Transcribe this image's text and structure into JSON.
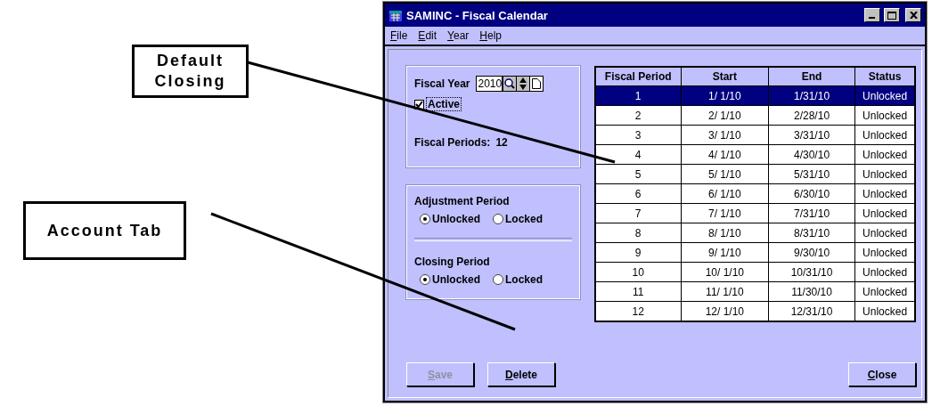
{
  "callouts": [
    {
      "text": "Default Closing"
    },
    {
      "text": "Account Tab"
    }
  ],
  "window": {
    "title": "SAMINC - Fiscal Calendar"
  },
  "menu": [
    {
      "label": "File"
    },
    {
      "label": "Edit"
    },
    {
      "label": "Year"
    },
    {
      "label": "Help"
    }
  ],
  "fiscal_year": {
    "label": "Fiscal Year",
    "value": "2010",
    "active": {
      "label": "Active",
      "checked": true
    },
    "periods_label": "Fiscal Periods:",
    "periods_value": "12"
  },
  "adjustment_period": {
    "label": "Adjustment Period",
    "options": [
      {
        "label": "Unlocked",
        "selected": true
      },
      {
        "label": "Locked",
        "selected": false
      }
    ]
  },
  "closing_period": {
    "label": "Closing Period",
    "options": [
      {
        "label": "Unlocked",
        "selected": true
      },
      {
        "label": "Locked",
        "selected": false
      }
    ]
  },
  "table": {
    "columns": [
      "Fiscal Period",
      "Start",
      "End",
      "Status"
    ],
    "rows": [
      {
        "cells": [
          "1",
          "1/ 1/10",
          "1/31/10",
          "Unlocked"
        ],
        "selected": true
      },
      {
        "cells": [
          "2",
          "2/ 1/10",
          "2/28/10",
          "Unlocked"
        ],
        "selected": false
      },
      {
        "cells": [
          "3",
          "3/ 1/10",
          "3/31/10",
          "Unlocked"
        ],
        "selected": false
      },
      {
        "cells": [
          "4",
          "4/ 1/10",
          "4/30/10",
          "Unlocked"
        ],
        "selected": false
      },
      {
        "cells": [
          "5",
          "5/ 1/10",
          "5/31/10",
          "Unlocked"
        ],
        "selected": false
      },
      {
        "cells": [
          "6",
          "6/ 1/10",
          "6/30/10",
          "Unlocked"
        ],
        "selected": false
      },
      {
        "cells": [
          "7",
          "7/ 1/10",
          "7/31/10",
          "Unlocked"
        ],
        "selected": false
      },
      {
        "cells": [
          "8",
          "8/ 1/10",
          "8/31/10",
          "Unlocked"
        ],
        "selected": false
      },
      {
        "cells": [
          "9",
          "9/ 1/10",
          "9/30/10",
          "Unlocked"
        ],
        "selected": false
      },
      {
        "cells": [
          "10",
          "10/ 1/10",
          "10/31/10",
          "Unlocked"
        ],
        "selected": false
      },
      {
        "cells": [
          "11",
          "11/ 1/10",
          "11/30/10",
          "Unlocked"
        ],
        "selected": false
      },
      {
        "cells": [
          "12",
          "12/ 1/10",
          "12/31/10",
          "Unlocked"
        ],
        "selected": false
      }
    ]
  },
  "buttons": [
    {
      "label": "Save",
      "disabled": true
    },
    {
      "label": "Delete",
      "disabled": false
    },
    {
      "label": "Close",
      "disabled": false
    }
  ]
}
